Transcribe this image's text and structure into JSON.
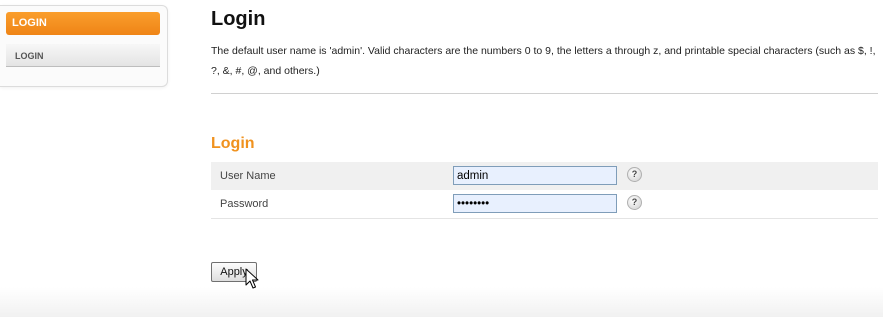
{
  "sidebar": {
    "header": "LOGIN",
    "items": [
      {
        "label": "LOGIN"
      }
    ]
  },
  "main": {
    "title": "Login",
    "description": "The default user name is 'admin'. Valid characters are the numbers 0 to 9, the letters a through z, and printable special characters (such as $, !, ?, &, #, @, and others.)",
    "section_title": "Login",
    "fields": {
      "username": {
        "label": "User Name",
        "value": "admin",
        "help": "?"
      },
      "password": {
        "label": "Password",
        "value": "password",
        "help": "?"
      }
    },
    "apply_label": "Apply"
  },
  "colors": {
    "accent": "#f0921e",
    "sidebar_header": "#ef8416",
    "input_fill": "#e8f0fe"
  },
  "icons": [
    "help-icon",
    "mouse-cursor-icon"
  ]
}
